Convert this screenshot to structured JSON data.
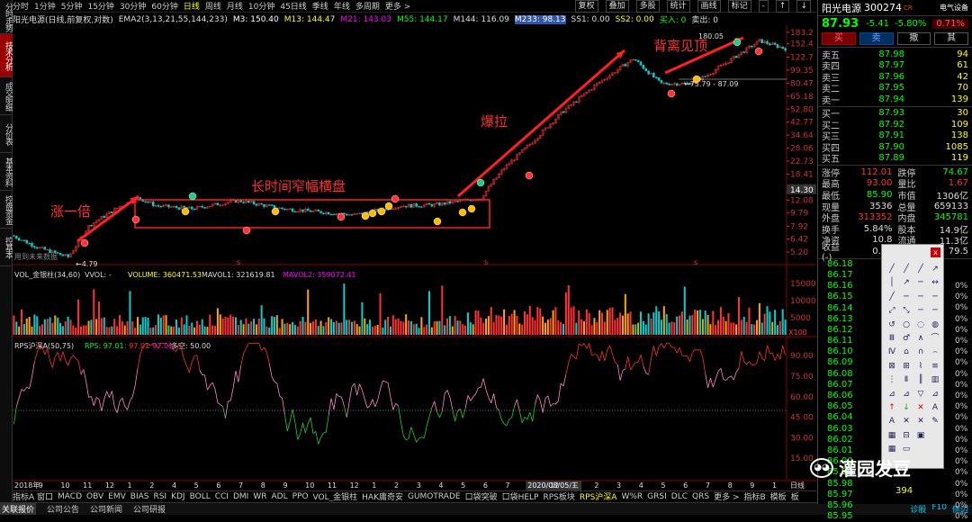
{
  "vtabs": [
    "分时走势",
    "技术分析",
    "成交明细",
    "分价表",
    "基本资料",
    "控盘资金",
    "控基本"
  ],
  "periods": [
    "分时",
    "1分钟",
    "5分钟",
    "15分钟",
    "30分钟",
    "60分钟",
    "日线",
    "周线",
    "月线",
    "10分钟",
    "45日线",
    "季线",
    "年线",
    "多周期",
    "更多 >"
  ],
  "active_period": "日线",
  "tools": [
    "复权",
    "叠加",
    "多股",
    "统计",
    "画线",
    "标记",
    "-",
    "↑",
    "↓"
  ],
  "legend": {
    "title": "阳光电源(日线,前复权,对数)",
    "ema": "EMA2(3,13,21,55,144,233)",
    "m3": "M3: 150.40",
    "m13": "M13: 144.47",
    "m21": "M21: 143.03",
    "m55": "M55: 144.17",
    "m144": "M144: 116.09",
    "m233": "M233: 98.13",
    "ss1": "SS1: 0.00",
    "ss2": "SS2: 0.00",
    "buy": "买入: 0",
    "sell": "卖出: 0"
  },
  "price_axis": [
    "183.2",
    "152.4",
    "122.7",
    "99.35",
    "80.47",
    "65.18",
    "52.80",
    "42.77",
    "34.64",
    "28.06",
    "22.73",
    "18.41",
    "14.91",
    "12.08",
    "9.79",
    "7.92",
    "6.42",
    "5.20"
  ],
  "crosshair_price": "14.30",
  "annotations": {
    "zhang_yi_bei": "涨一倍",
    "narrow": "长时间窄幅横盘",
    "baola": "爆拉",
    "beili": "背离见顶",
    "low": "4.79",
    "high": "180.05",
    "range": "75.79 - 87.09",
    "future": "用到未来数据"
  },
  "vol": {
    "title": "VOL_金银柱(34,60)",
    "vvol": "VVOL: -",
    "volume": "VOLUME: 360471.53",
    "mavol1": "MAVOL1: 321619.81",
    "mavol2": "MAVOL2: 359072.41",
    "axis": [
      "15000",
      "10000",
      "5000"
    ],
    "unit": "X100"
  },
  "rps": {
    "title": "RPS沪深A(50,75)",
    "rps": "RPS: 97.01",
    "v2": ": 97.01",
    "v3": ": 97.01",
    "v4": "多空: 50.00",
    "axis": [
      "90.00",
      "75.00",
      "60.00",
      "45.00",
      "30.00",
      "15.00"
    ]
  },
  "xaxis": {
    "labels": [
      "2018年",
      "9",
      "10",
      "11",
      "12",
      "1",
      "2",
      "4",
      "5",
      "6",
      "7",
      "8",
      "9",
      "10",
      "11",
      "12",
      "1",
      "2",
      "3",
      "4",
      "5",
      "6",
      "7",
      "2020/08/05/三",
      "12",
      "1",
      "2",
      "3",
      "4",
      "5",
      "6",
      "7",
      "8",
      "9",
      "1"
    ],
    "right": "日线"
  },
  "bottom_tabs": [
    "指标A 窗口",
    "MACD",
    "OBV",
    "EMV",
    "BIAS",
    "RSI",
    "KDJ",
    "BOLL",
    "CCI",
    "DMI",
    "WR",
    "ADL",
    "PPO",
    "VOL_金银柱",
    "HAK庸奇安",
    "GUMOTRADE",
    "口袋突破",
    "口袋HELP",
    "RPS板块",
    "RPS沪深A",
    "W%R",
    "GRSI",
    "DLC",
    "QRS",
    "更多 >",
    "指标B",
    "模板",
    "板"
  ],
  "active_bottom": "RPS沪深A",
  "status": [
    "关联报价",
    "公司公告",
    "公司新闻",
    "公司研报"
  ],
  "status_right": [
    "诊股",
    "F10",
    "侧边"
  ],
  "rp": {
    "name": "阳光电源",
    "code": "300274",
    "cr": "CR",
    "industry": "电气设备",
    "price": "87.93",
    "change": "-5.41",
    "pct": "-5.80%",
    "turnover_rate": "0.71%",
    "btn_buy": "买",
    "btn_sell": "卖",
    "btn_cancel": "撤",
    "btn_other": "其",
    "sells": [
      [
        "卖五",
        "87.98",
        "94"
      ],
      [
        "卖四",
        "87.97",
        "61"
      ],
      [
        "卖三",
        "87.96",
        "42"
      ],
      [
        "卖二",
        "87.95",
        "70"
      ],
      [
        "卖一",
        "87.94",
        "139"
      ]
    ],
    "buys": [
      [
        "买一",
        "87.93",
        "30"
      ],
      [
        "买二",
        "87.92",
        "109"
      ],
      [
        "买三",
        "87.91",
        "138"
      ],
      [
        "买四",
        "87.90",
        "1085"
      ],
      [
        "买五",
        "87.89",
        "119"
      ]
    ],
    "stats": [
      [
        "涨停",
        "112.01",
        "跌停",
        "74.67"
      ],
      [
        "最高",
        "93.00",
        "量比",
        "1.67"
      ],
      [
        "最低",
        "85.90",
        "市值",
        "1306亿"
      ],
      [
        "现量",
        "3536",
        "总量",
        "659133"
      ],
      [
        "外盘",
        "313352",
        "内盘",
        "345781"
      ],
      [
        "换手",
        "5.84%",
        "股本",
        "14.9亿"
      ],
      [
        "净资",
        "10.8",
        "流通",
        "11.3亿"
      ],
      [
        "收益(-)",
        "0.28",
        "PE",
        "79.5"
      ]
    ],
    "ticks": [
      "86.18",
      "86.17",
      "86.16",
      "86.15",
      "86.14",
      "86.13",
      "86.12",
      "86.11",
      "86.10",
      "86.09",
      "86.08",
      "86.07",
      "86.06",
      "86.05",
      "86.04",
      "86.03",
      "86.02",
      "86.01",
      "86.00",
      "85.99",
      "85.98",
      "85.97",
      "85.96",
      "85.95"
    ],
    "tick_right": [
      "0%",
      "0%",
      "0%",
      "0%",
      "0%",
      "0%",
      "0%",
      "0%",
      "0%",
      "0%",
      "0%",
      "0%",
      "0%",
      "0%",
      "0%",
      "0%",
      "0%",
      "0%",
      "0%",
      "0%",
      "0%",
      "0%"
    ],
    "last_vol": "394"
  },
  "palette": [
    "╱",
    "╱",
    "╱",
    "↗",
    "│",
    "↗",
    "─",
    "↔",
    "╱",
    "─",
    "─",
    "─",
    "⤢",
    "⤡",
    "─",
    "─",
    "↺",
    "○",
    "◌",
    "◍",
    "Ⅲ",
    "♂",
    "∧",
    "⌒",
    "Ⅳ",
    "⌂",
    "∩",
    "⌢",
    "⊠",
    "⊞",
    "⌇",
    "≡",
    "⋮",
    "Ⅱ",
    "║",
    "▥",
    "⊿",
    "⊿",
    "▽",
    "⊿",
    "↑",
    "↓",
    "✕",
    "A",
    "A",
    "✕",
    "✕",
    "✎",
    "▦",
    "⊟",
    "▣",
    "",
    "▦",
    "▭",
    "",
    ""
  ],
  "watermark": "灌园发豆"
}
